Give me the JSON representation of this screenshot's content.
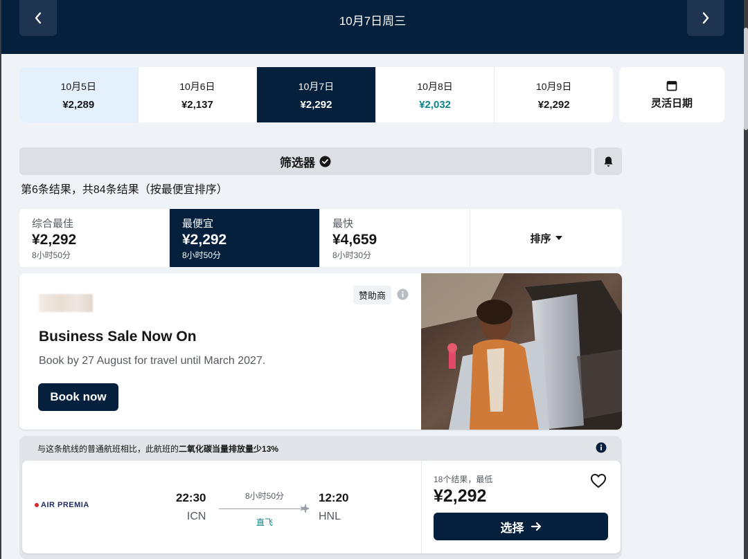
{
  "header": {
    "date": "10月7日周三"
  },
  "date_strip": [
    {
      "date": "10月5日",
      "price": "¥2,289"
    },
    {
      "date": "10月6日",
      "price": "¥2,137"
    },
    {
      "date": "10月7日",
      "price": "¥2,292"
    },
    {
      "date": "10月8日",
      "price": "¥2,032"
    },
    {
      "date": "10月9日",
      "price": "¥2,292"
    }
  ],
  "flex_dates": {
    "label": "灵活日期",
    "icon": "calendar-icon"
  },
  "filters": {
    "label": "筛选器",
    "icon": "check-circle-icon",
    "alert_icon": "bell-icon"
  },
  "results_summary": "第6条结果，共84条结果（按最便宜排序）",
  "sort_tabs": [
    {
      "title": "综合最佳",
      "price": "¥2,292",
      "duration": "8小时50分"
    },
    {
      "title": "最便宜",
      "price": "¥2,292",
      "duration": "8小时50分"
    },
    {
      "title": "最快",
      "price": "¥4,659",
      "duration": "8小时30分"
    }
  ],
  "sort_dropdown": {
    "label": "排序"
  },
  "ad": {
    "sponsor_label": "赞助商",
    "title": "Business Sale Now On",
    "subtitle": "Book by 27 August for travel until March 2027.",
    "button": "Book now"
  },
  "flight_card": {
    "eco_prefix": "与这条航线的普通航班相比，此航班的",
    "eco_bold": "二氧化碳当量排放量少13%",
    "airline": "AIR PREMIA",
    "dep_time": "22:30",
    "dep_code": "ICN",
    "duration": "8小时50分",
    "stops": "直飞",
    "arr_time": "12:20",
    "arr_code": "HNL",
    "results_note": "18个结果，最低",
    "price": "¥2,292",
    "select_label": "选择"
  },
  "colors": {
    "navy": "#05203c",
    "teal": "#0c838a",
    "soft_blue": "#e4f1fd",
    "page_bg": "#eff3f8"
  }
}
